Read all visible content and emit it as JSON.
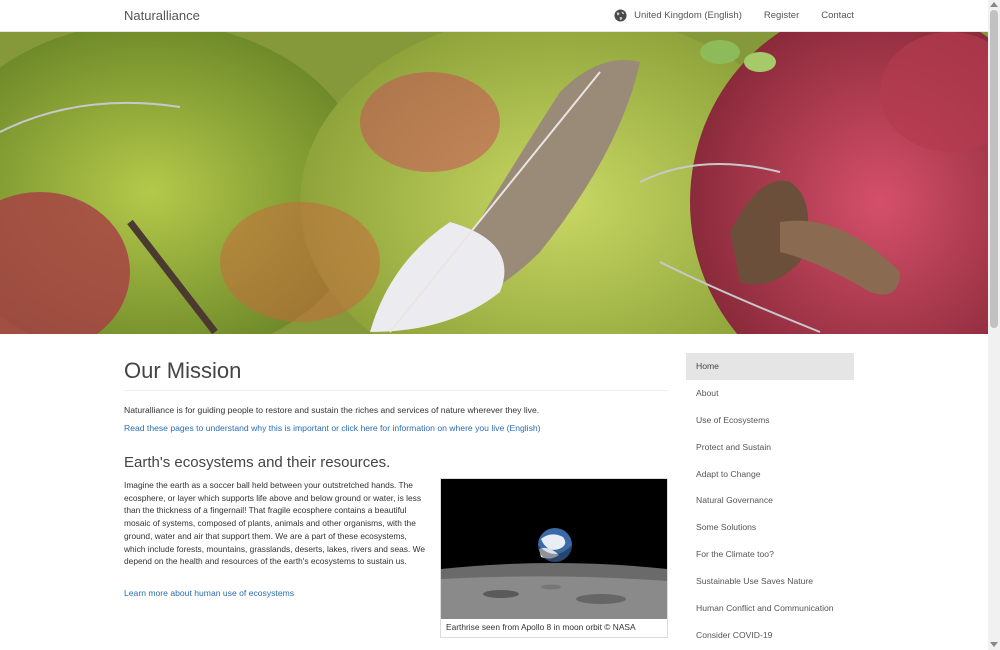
{
  "navbar": {
    "brand": "Naturalliance",
    "region": "United Kingdom (English)",
    "register": "Register",
    "contact": "Contact"
  },
  "hero": {
    "image": "moss-feather-photo"
  },
  "main": {
    "title": "Our Mission",
    "lead": "Naturalliance is for guiding people to restore and sustain the riches and services of nature wherever they live.",
    "lead_link": "Read these pages to understand why this is important or click here for information on where you live (English)",
    "subtitle": "Earth's ecosystems and their resources.",
    "body": "Imagine the earth as a soccer ball held between your outstretched hands. The ecosphere, or layer which supports life above and below ground or water, is less than the thickness of a fingernail! That fragile ecosphere contains a beautiful mosaic of systems, composed of plants, animals and other organisms, with the ground, water and air that support them. We are a part of these ecosystems, which include forests, mountains, grasslands, deserts, lakes, rivers and seas. We depend on the health and resources of the earth's ecosystems to sustain us.",
    "more_link": "Learn more about human use of ecosystems",
    "figure_caption": "Earthrise seen from Apollo 8 in moon orbit © NASA"
  },
  "sidebar": {
    "items": [
      {
        "label": "Home"
      },
      {
        "label": "About"
      },
      {
        "label": "Use of Ecosystems"
      },
      {
        "label": "Protect and Sustain"
      },
      {
        "label": "Adapt to Change"
      },
      {
        "label": "Natural Governance"
      },
      {
        "label": "Some Solutions"
      },
      {
        "label": "For the Climate too?"
      },
      {
        "label": "Sustainable Use Saves Nature"
      },
      {
        "label": "Human Conflict and Communication"
      },
      {
        "label": "Consider COVID-19"
      }
    ]
  },
  "colors": {
    "link": "#2a6cb0",
    "active_bg": "#e5e5e5"
  }
}
